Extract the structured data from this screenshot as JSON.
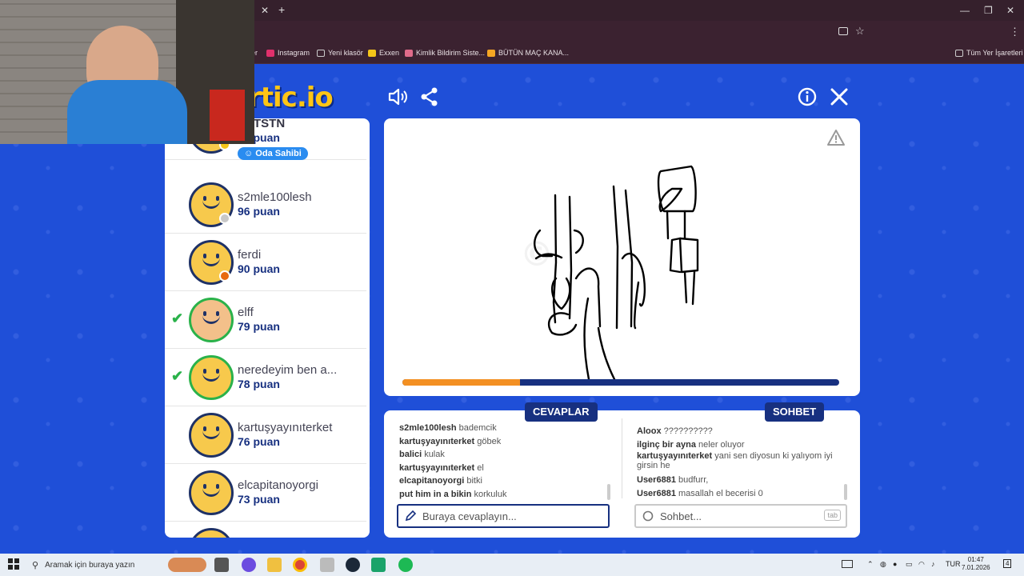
{
  "browser": {
    "bookmarks": [
      {
        "label": "Instagram",
        "color": "#e1306c"
      },
      {
        "label": "Yeni klasör",
        "color": "#cccccc"
      },
      {
        "label": "Exxen",
        "color": "#f5c518"
      },
      {
        "label": "Kimlik Bildirim Siste...",
        "color": "#e06b8a"
      },
      {
        "label": "BÜTÜN MAÇ KANA...",
        "color": "#f5a623"
      }
    ],
    "all_bookmarks": "Tüm Yer İşaretleri",
    "bm_prefix": "er"
  },
  "game": {
    "logo": "rtic.io",
    "players": [
      {
        "name": "ZNTSTN",
        "score": "99 puan",
        "badge": "Oda Sahibi",
        "status_color": "#f5c518",
        "guessed": false
      },
      {
        "name": "s2mle100lesh",
        "score": "96 puan",
        "status_color": "#c8c8c8",
        "guessed": false
      },
      {
        "name": "ferdi",
        "score": "90 puan",
        "status_color": "#e86a10",
        "guessed": false
      },
      {
        "name": "elff",
        "score": "79 puan",
        "guessed": true
      },
      {
        "name": "neredeyim ben a...",
        "score": "78 puan",
        "guessed": true
      },
      {
        "name": "kartuşyayınıterket",
        "score": "76 puan",
        "guessed": false
      },
      {
        "name": "elcapitanoyorgi",
        "score": "73 puan",
        "guessed": false
      }
    ],
    "progress_fraction": 0.27,
    "answers_tab": "CEVAPLAR",
    "chat_tab": "SOHBET",
    "answers": [
      {
        "user": "s2mle100lesh",
        "text": "bademcik"
      },
      {
        "user": "kartuşyayınıterket",
        "text": "göbek"
      },
      {
        "user": "balici",
        "text": "kulak"
      },
      {
        "user": "kartuşyayınıterket",
        "text": "el"
      },
      {
        "user": "elcapitanoyorgi",
        "text": "bitki"
      },
      {
        "user": "put him in a bikin",
        "text": "korkuluk"
      }
    ],
    "chat": [
      {
        "user": "Aloox",
        "text": "??????????"
      },
      {
        "user": "ilginç bir ayna",
        "text": "neler oluyor"
      },
      {
        "user": "kartuşyayınıterket",
        "text": "yani sen diyosun ki yalıyom iyi girsin he"
      },
      {
        "user": "User6881",
        "text": "budfurr,"
      },
      {
        "user": "User6881",
        "text": "masallah el becerisi 0"
      }
    ],
    "answer_placeholder": "Buraya cevaplayın...",
    "chat_placeholder": "Sohbet...",
    "tab_key": "tab"
  },
  "taskbar": {
    "search_placeholder": "Aramak için buraya yazın",
    "lang": "TUR",
    "time": "01:47",
    "date": "7.01.2026",
    "notif_count": "4"
  }
}
